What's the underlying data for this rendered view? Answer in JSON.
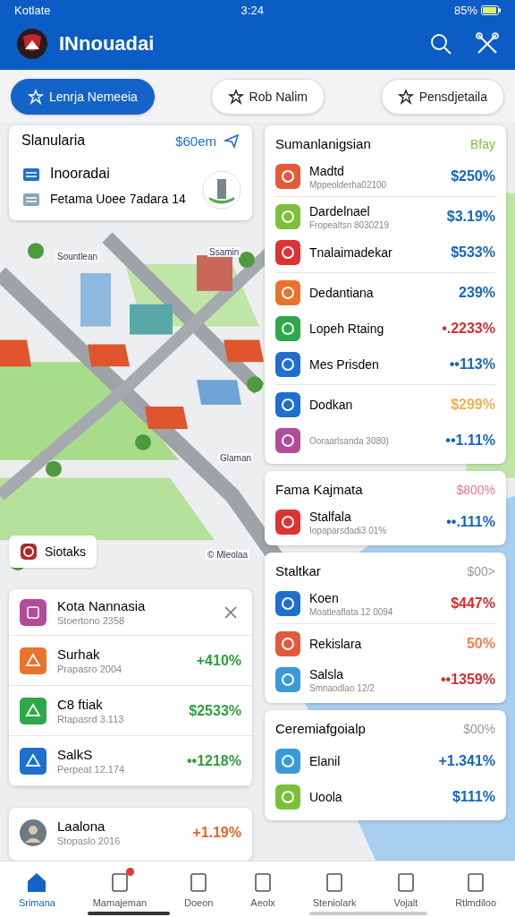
{
  "status_bar": {
    "carrier": "Kotlate",
    "time": "3:24",
    "battery": "85%"
  },
  "header": {
    "title": "INnouadai"
  },
  "filters": [
    {
      "label": "Lenrja Nemeeia",
      "selected": true
    },
    {
      "label": "Rob Nalim",
      "selected": false
    },
    {
      "label": "Pensdjetaila",
      "selected": false
    }
  ],
  "location_card": {
    "title": "Slanularia",
    "amount": "$60em",
    "rows": [
      "Inooradai",
      "Fetama Uoee 7adara 14"
    ]
  },
  "map": {
    "labels": [
      "Sountlean",
      "Ssamin",
      "Glaman",
      "© Mleolaa"
    ],
    "place_chip": "Siotaks"
  },
  "list_card": {
    "title": "Kota Nannasia",
    "subtitle": "Stoertono 2358",
    "items": [
      {
        "name": "Surhak",
        "sub": "Prapasro 2004",
        "value": "+410%",
        "color": "#2e9e3e"
      },
      {
        "name": "C8 ftiak",
        "sub": "Rtapasrd 3.113",
        "value": "$2533%",
        "color": "#2e9e3e"
      },
      {
        "name": "SalkS",
        "sub": "Perpeat 12.174",
        "value": "••1218%",
        "color": "#2e9e3e"
      }
    ]
  },
  "extra_card": {
    "items": [
      {
        "name": "Laalona",
        "sub": "Stopaslo 2016",
        "value": "+1.19%",
        "color": "#e8622a"
      }
    ]
  },
  "panels": [
    {
      "title": "Sumanlanigsian",
      "header_value": "Bfay",
      "color": "#7cc242",
      "groups": [
        [
          {
            "name": "Madtd",
            "sub": "Mppeolderha02100",
            "value": "$250%",
            "color": "#1565c0"
          }
        ],
        [
          {
            "name": "Dardelnael",
            "sub": "Fropealtsn 8030219",
            "value": "$3.19%",
            "color": "#1565c0"
          },
          {
            "name": "Tnalaimadekar",
            "value": "$533%",
            "color": "#1565c0"
          }
        ],
        [
          {
            "name": "Dedantiana",
            "value": "239%",
            "color": "#1565c0"
          },
          {
            "name": "Lopeh Rtaing",
            "value": "•.2233%",
            "color": "#d32f2f"
          },
          {
            "name": "Mes Prisden",
            "value": "••113%",
            "color": "#1565c0"
          }
        ],
        [
          {
            "name": "Dodkan",
            "value": "$299%",
            "color": "#f0b050"
          },
          {
            "sub": "Ooraarlsanda 3080)",
            "value": "••1.11%",
            "color": "#1565c0"
          }
        ]
      ]
    },
    {
      "title": "Fama Kajmata",
      "header_value": "$800%",
      "color": "#e07a8a",
      "groups": [
        [
          {
            "name": "Stalfala",
            "sub": "Iopaparsdadi3 01%",
            "value": "••.111%",
            "color": "#1565c0"
          }
        ]
      ]
    },
    {
      "title": "Staltkar",
      "header_value": "$00>",
      "color": "#9a9a9a",
      "groups": [
        [
          {
            "name": "Koen",
            "sub": "Moatleaflata 12 0094",
            "value": "$447%",
            "color": "#d32f2f"
          }
        ],
        [
          {
            "name": "Rekislara",
            "value": "50%",
            "color": "#f08050"
          },
          {
            "name": "Salsla",
            "sub": "Smnaodlao 12/2",
            "value": "••1359%",
            "color": "#d32f2f"
          }
        ]
      ]
    },
    {
      "title": "Ceremiafgoialp",
      "header_value": "$00%",
      "color": "#9a9a9a",
      "groups": [
        [
          {
            "name": "Elanil",
            "value": "+1.341%",
            "color": "#1565c0"
          },
          {
            "name": "Uoola",
            "value": "$111%",
            "color": "#1565c0"
          }
        ]
      ]
    }
  ],
  "nav": [
    {
      "label": "Srimana",
      "selected": true,
      "badge": false
    },
    {
      "label": "Mamajeman",
      "selected": false,
      "badge": true
    },
    {
      "label": "Doeon",
      "selected": false,
      "badge": false
    },
    {
      "label": "Aeolx",
      "selected": false,
      "badge": false
    },
    {
      "label": "Steniolark",
      "selected": false,
      "badge": false
    },
    {
      "label": "Vojalt",
      "selected": false,
      "badge": false
    },
    {
      "label": "Rtlmdiloo",
      "selected": false,
      "badge": false
    }
  ]
}
